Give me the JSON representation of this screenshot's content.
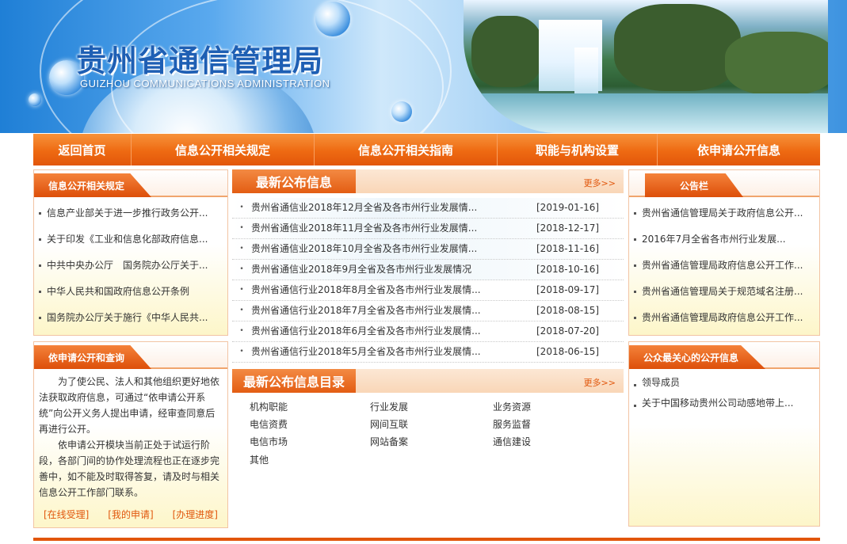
{
  "header": {
    "title": "贵州省通信管理局",
    "subtitle": "GUIZHOU COMMUNICATIONS ADMINISTRATION"
  },
  "nav": [
    {
      "label": "返回首页"
    },
    {
      "label": "信息公开相关规定"
    },
    {
      "label": "信息公开相关指南"
    },
    {
      "label": "职能与机构设置"
    },
    {
      "label": "依申请公开信息"
    }
  ],
  "left_regulations": {
    "title": "信息公开相关规定",
    "items": [
      "信息产业部关于进一步推行政务公开...",
      "关于印发《工业和信息化部政府信息...",
      "中共中央办公厅　国务院办公厅关于...",
      "中华人民共和国政府信息公开条例",
      "国务院办公厅关于施行《中华人民共..."
    ]
  },
  "left_apply": {
    "title": "依申请公开和查询",
    "para1": "为了使公民、法人和其他组织更好地依法获取政府信息，可通过“依申请公开系统”向公开义务人提出申请，经审查同意后再进行公开。",
    "para2": "依申请公开模块当前正处于试运行阶段，各部门间的协作处理流程也正在逐步完善中，如不能及时取得答复，请及时与相关信息公开工作部门联系。",
    "links": [
      "[在线受理]",
      "[我的申请]",
      "[办理进度]"
    ]
  },
  "latest_news": {
    "title": "最新公布信息",
    "more": "更多>>",
    "items": [
      {
        "title": "贵州省通信业2018年12月全省及各市州行业发展情...",
        "date": "[2019-01-16]"
      },
      {
        "title": "贵州省通信业2018年11月全省及各市州行业发展情...",
        "date": "[2018-12-17]"
      },
      {
        "title": "贵州省通信业2018年10月全省及各市州行业发展情...",
        "date": "[2018-11-16]"
      },
      {
        "title": "贵州省通信业2018年9月全省及各市州行业发展情况",
        "date": "[2018-10-16]"
      },
      {
        "title": "贵州省通信行业2018年8月全省及各市州行业发展情...",
        "date": "[2018-09-17]"
      },
      {
        "title": "贵州省通信行业2018年7月全省及各市州行业发展情...",
        "date": "[2018-08-15]"
      },
      {
        "title": "贵州省通信行业2018年6月全省及各市州行业发展情...",
        "date": "[2018-07-20]"
      },
      {
        "title": "贵州省通信行业2018年5月全省及各市州行业发展情...",
        "date": "[2018-06-15]"
      }
    ]
  },
  "catalog": {
    "title": "最新公布信息目录",
    "more": "更多>>",
    "items": [
      "机构职能",
      "行业发展",
      "业务资源",
      "电信资费",
      "网间互联",
      "服务监督",
      "电信市场",
      "网站备案",
      "通信建设",
      "其他"
    ]
  },
  "notice": {
    "title": "公告栏",
    "items": [
      "贵州省通信管理局关于政府信息公开...",
      "2016年7月全省各市州行业发展...",
      "贵州省通信管理局政府信息公开工作...",
      "贵州省通信管理局关于规范域名注册...",
      "贵州省通信管理局政府信息公开工作..."
    ]
  },
  "public_concern": {
    "title": "公众最关心的公开信息",
    "items": [
      "领导成员",
      "关于中国移动贵州公司动感地带上..."
    ]
  }
}
